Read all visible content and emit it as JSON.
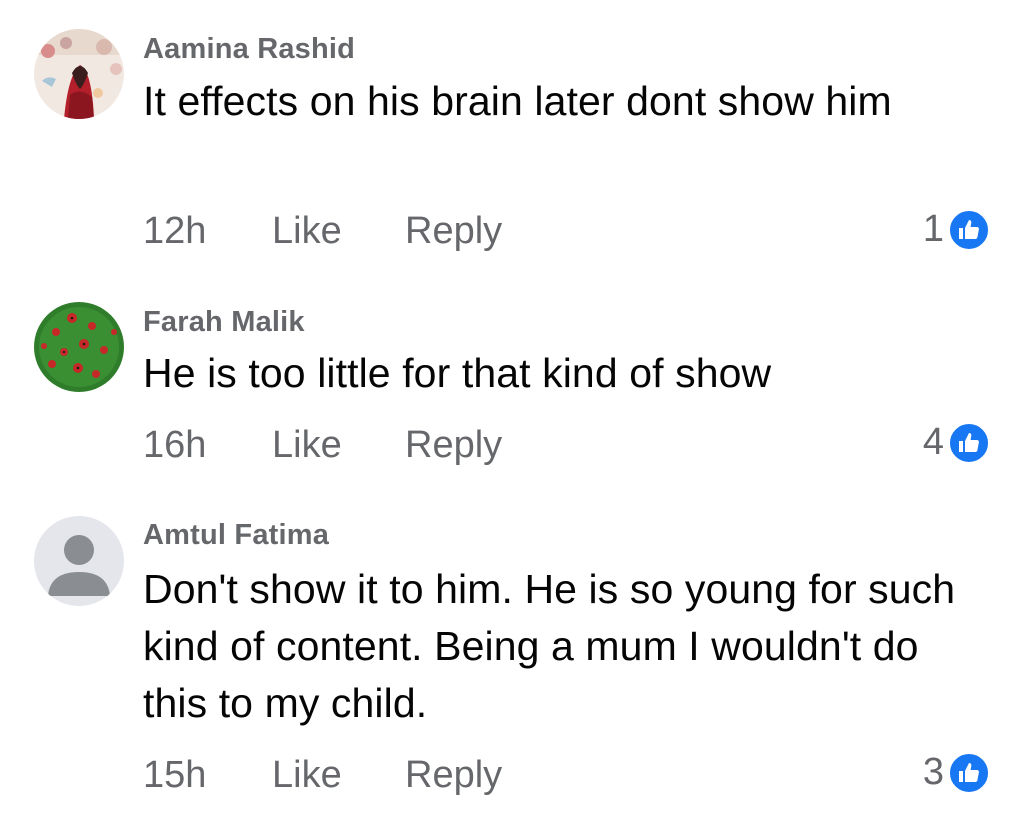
{
  "comments": [
    {
      "author": "Aamina Rashid",
      "text": "It effects on his brain later dont show him",
      "time": "12h",
      "like_label": "Like",
      "reply_label": "Reply",
      "reactions": "1",
      "avatar": "photo-avatar"
    },
    {
      "author": "Farah Malik",
      "text": "He is too little for that kind of show",
      "time": "16h",
      "like_label": "Like",
      "reply_label": "Reply",
      "reactions": "4",
      "avatar": "ladybug-pattern-avatar"
    },
    {
      "author": "Amtul Fatima",
      "text": "Don't show it to him. He is so young for such kind of content. Being a mum I wouldn't do this to my child.",
      "time": "15h",
      "like_label": "Like",
      "reply_label": "Reply",
      "reactions": "3",
      "avatar": "default-person-avatar"
    }
  ],
  "colors": {
    "name_gray": "#65676b",
    "text_black": "#050505",
    "like_blue": "#1877f2",
    "avatar_default_bg": "#e4e6eb",
    "avatar_default_fg": "#8a8d91",
    "avatar_green": "#2f7d2a",
    "ladybug_red": "#c62828"
  },
  "icons": {
    "reaction": "thumbs-up-icon"
  }
}
